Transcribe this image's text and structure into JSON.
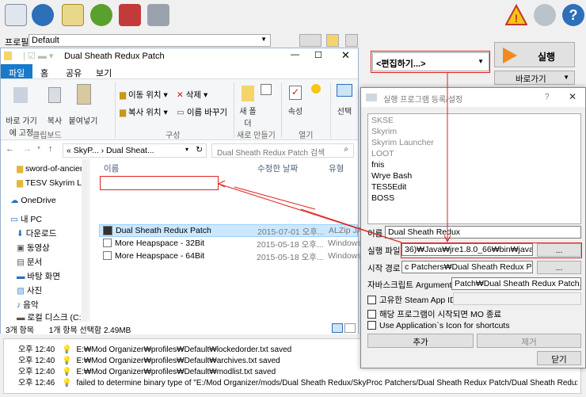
{
  "profile": {
    "label": "프로필",
    "value": "Default"
  },
  "run": {
    "selector": "<편집하기...>",
    "run_label": "실행",
    "shortcut_label": "바로가기"
  },
  "explorer": {
    "title": "Dual Sheath Redux Patch",
    "tabs": [
      "파일",
      "홈",
      "공유",
      "보기"
    ],
    "ribbon": {
      "pin": "바로 가기에 고정",
      "copy": "복사",
      "paste": "붙여넣기",
      "move_to": "이동 위치",
      "delete": "삭제",
      "copy_to": "복사 위치",
      "rename": "이름 바꾸기",
      "new_folder": "새 폴더",
      "properties": "속성",
      "select": "선택",
      "grp_clipboard": "클립보드",
      "grp_organize": "구성",
      "grp_new": "새로 만들기",
      "grp_open": "열기"
    },
    "address": "« SkyP... › Dual Sheat...",
    "search_placeholder": "Dual Sheath Redux Patch 검색",
    "nav": [
      "sword-of-ancier",
      "TESV Skyrim LE",
      "OneDrive",
      "내 PC",
      "다운로드",
      "동영상",
      "문서",
      "바탕 화면",
      "사진",
      "음악",
      "로컬 디스크 (C:)"
    ],
    "columns": {
      "name": "이름",
      "date": "수정한 날짜",
      "type": "유형"
    },
    "files": [
      {
        "name": "Dual Sheath Redux Patch",
        "date": "2015-07-01 오후...",
        "type": "ALZip JAR"
      },
      {
        "name": "More Heapspace - 32Bit",
        "date": "2015-05-18 오후...",
        "type": "Windows"
      },
      {
        "name": "More Heapspace - 64Bit",
        "date": "2015-05-18 오후...",
        "type": "Windows"
      }
    ],
    "status_count": "3개 항목",
    "status_sel": "1개 항목 선택함 2.49MB"
  },
  "dialog": {
    "title": "실행 프로그램 등록/설정",
    "help": "?",
    "executables": [
      "SKSE",
      "Skyrim",
      "Skyrim Launcher",
      "LOOT",
      "fnis",
      "Wrye Bash",
      "TES5Edit",
      "BOSS"
    ],
    "name_label": "이름",
    "name_value": "Dual Sheath Redux",
    "binary_label": "실행 파일",
    "binary_value": "36)₩Java₩jre1.8.0_66₩bin₩javaw.exe",
    "start_label": "시작 경로",
    "start_value": "c Patchers₩Dual Sheath Redux Patch",
    "args_label": "자바스크립트 Arguments",
    "args_value": "Patch₩Dual Sheath Redux Patch.jar\"",
    "browse": "...",
    "steam_label": "고유한 Steam App ID",
    "close_mo_label": "해당 프로그램이 시작되면 MO 종료",
    "app_icon_label": "Use Application`s Icon for shortcuts",
    "add": "추가",
    "remove": "제거",
    "close": "닫기"
  },
  "log": [
    {
      "time": "오후 12:40",
      "msg": "E:₩Mod Organizer₩profiles₩Default₩lockedorder.txt saved"
    },
    {
      "time": "오후 12:40",
      "msg": "E:₩Mod Organizer₩profiles₩Default₩archives.txt saved"
    },
    {
      "time": "오후 12:40",
      "msg": "E:₩Mod Organizer₩profiles₩Default₩modlist.txt saved"
    },
    {
      "time": "오후 12:46",
      "msg": "failed to determine binary type of \"E:/Mod Organizer/mods/Dual Sheath Redux/SkyProc Patchers/Dual Sheath Redux Patch/Dual Sheath Redux Patch.ja..."
    }
  ],
  "colors": {
    "accent": "#1979ca",
    "annotation": "#e02020",
    "run_orange": "#f08a1c"
  }
}
